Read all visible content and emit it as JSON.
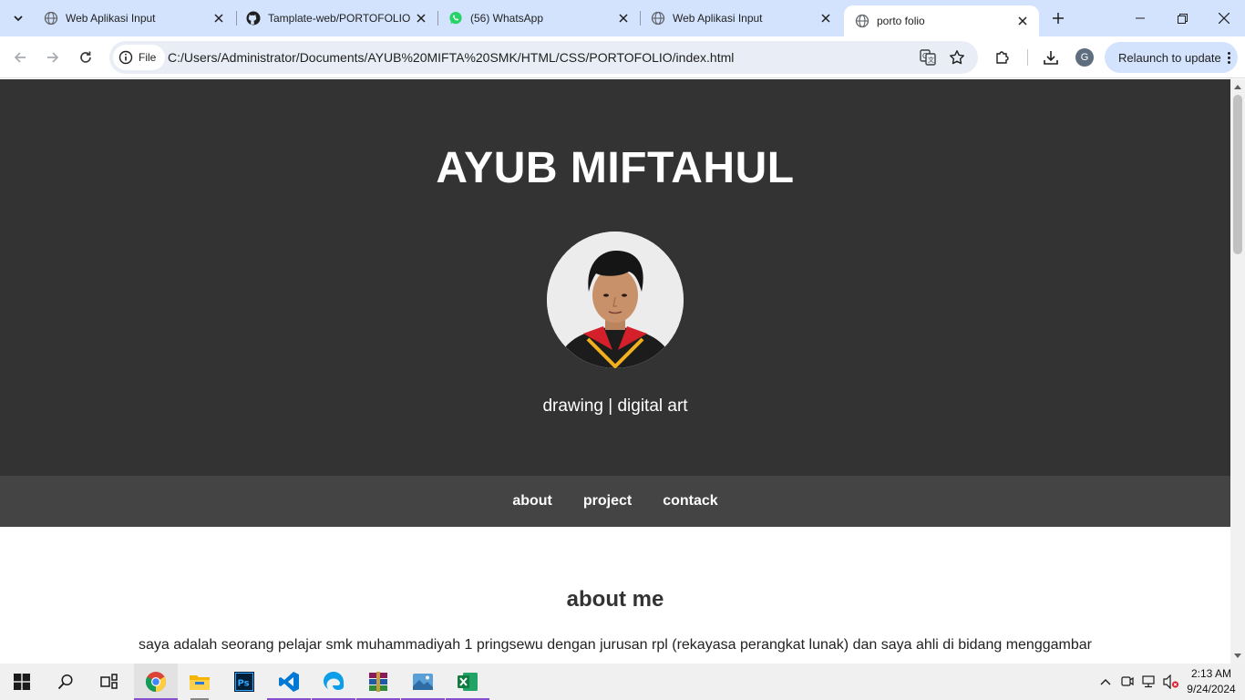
{
  "browser": {
    "tabs": [
      {
        "title": "Web Aplikasi Input",
        "active": false
      },
      {
        "title": "Tamplate-web/PORTOFOLIO",
        "active": false
      },
      {
        "title": "(56) WhatsApp",
        "active": false
      },
      {
        "title": "Web Aplikasi Input",
        "active": false
      },
      {
        "title": "porto folio",
        "active": true
      }
    ],
    "address": {
      "scheme_chip": "File",
      "url": "C:/Users/Administrator/Documents/AYUB%20MIFTA%20SMK/HTML/CSS/PORTOFOLIO/index.html"
    },
    "profile_initial": "G",
    "relaunch_label": "Relaunch to update"
  },
  "page": {
    "name": "AYUB MIFTAHUL",
    "tagline": "drawing | digital art",
    "nav": [
      "about",
      "project",
      "contack"
    ],
    "about_title": "about me",
    "about_text": "saya adalah seorang pelajar smk muhammadiyah 1 pringsewu dengan jurusan rpl (rekayasa perangkat lunak) dan saya ahli di bidang menggambar"
  },
  "taskbar": {
    "apps": [
      "start-icon",
      "search-icon",
      "task-view-icon",
      "chrome-icon",
      "file-explorer-icon",
      "photoshop-icon",
      "vscode-icon",
      "edge-icon",
      "winrar-icon",
      "photos-icon",
      "excel-icon"
    ],
    "clock_time": "2:13 AM",
    "clock_date": "9/24/2024"
  },
  "colors": {
    "tab_strip": "#d3e3fd",
    "hero_bg": "#333333",
    "nav_bg": "#444444",
    "accent_taskbar": "#8a4fcf"
  }
}
